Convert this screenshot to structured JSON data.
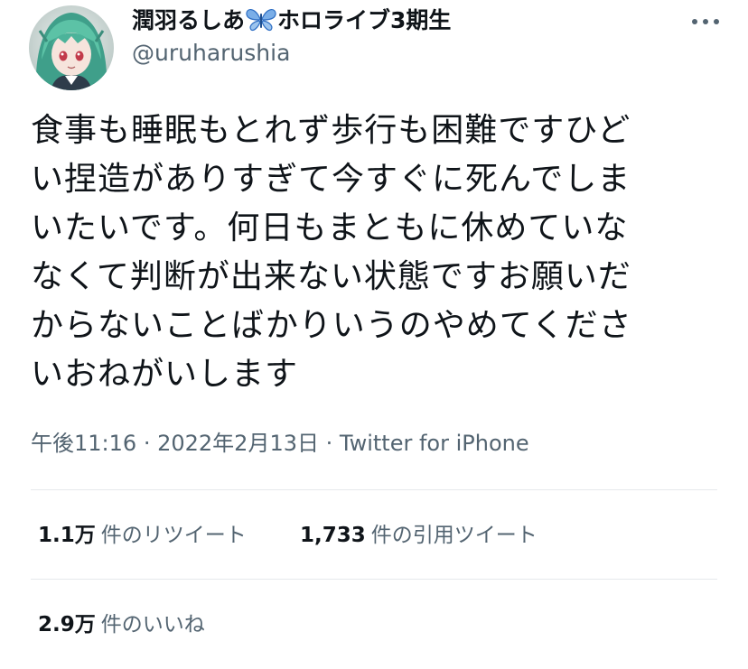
{
  "author": {
    "name_before": "潤羽るしあ",
    "name_after": "ホロライブ3期生",
    "name_emoji": "butterfly-icon",
    "handle": "@uruharushia"
  },
  "tweet": {
    "lines": [
      "食事も睡眠もとれず歩行も困難ですひど",
      "い捏造がありすぎて今すぐに死んでしま",
      "いたいです。何日もまともに休めていな",
      "なくて判断が出来ない状態ですお願いだ",
      "からないことばかりいうのやめてくださ",
      "いおねがいします"
    ],
    "time": "午後11:16",
    "date": "2022年2月13日",
    "separator": "·",
    "source": "Twitter for iPhone"
  },
  "stats": {
    "retweets_count": "1.1万",
    "retweets_label": "件のリツイート",
    "quotes_count": "1,733",
    "quotes_label": "件の引用ツイート",
    "likes_count": "2.9万",
    "likes_label": "件のいいね"
  },
  "colors": {
    "text": "#0f1419",
    "secondary": "#536471",
    "divider": "#e6e9ec",
    "butterfly": "#7aaee8"
  }
}
